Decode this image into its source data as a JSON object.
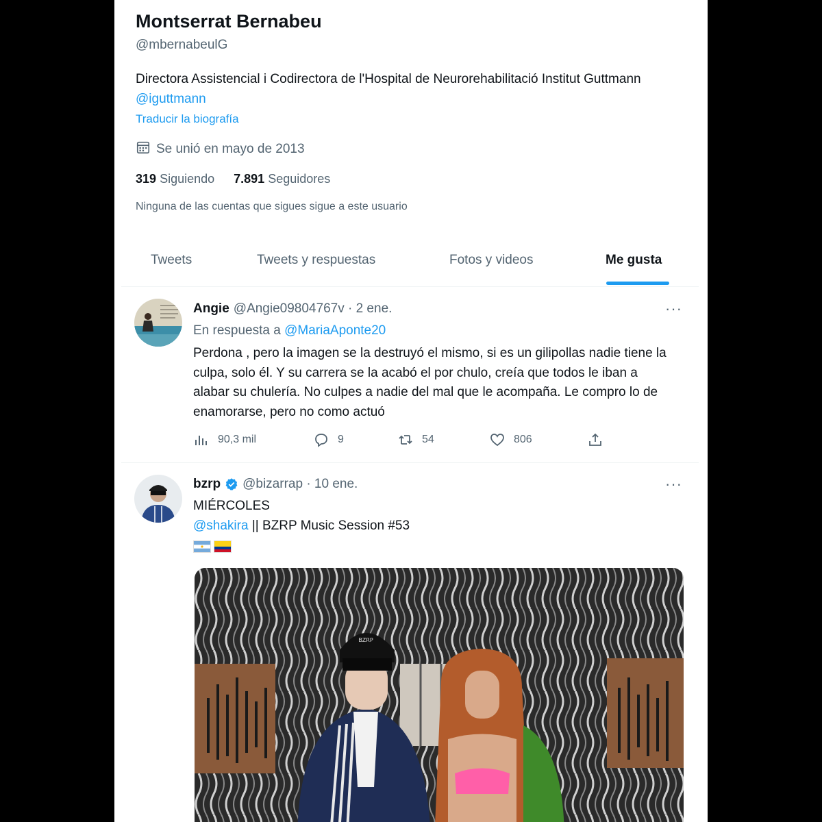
{
  "profile": {
    "name": "Montserrat Bernabeu",
    "handle": "@mbernabeulG",
    "bio_text": "Directora Assistencial i Codirectora de l'Hospital de Neurorehabilitació Institut Guttmann ",
    "bio_mention": "@iguttmann",
    "translate_link": "Traducir la biografía",
    "joined": "Se unió en mayo de 2013",
    "following_count": "319",
    "following_label": "Siguiendo",
    "followers_count": "7.891",
    "followers_label": "Seguidores",
    "no_followers_text": "Ninguna de las cuentas que sigues sigue a este usuario"
  },
  "tabs": [
    {
      "label": "Tweets",
      "active": false
    },
    {
      "label": "Tweets y respuestas",
      "active": false
    },
    {
      "label": "Fotos y videos",
      "active": false
    },
    {
      "label": "Me gusta",
      "active": true
    }
  ],
  "tweets": [
    {
      "author": "Angie",
      "handle": "@Angie09804767v",
      "date": "· 2 ene.",
      "reply_prefix": "En respuesta a",
      "reply_to": "@MariaAponte20",
      "text": "Perdona , pero la imagen se la destruyó el mismo, si es un gilipollas nadie tiene la culpa, solo él. Y su carrera se la acabó el por chulo, creía que todos le iban a alabar su chulería. No culpes a nadie del mal que le acompaña. Le compro lo de enamorarse, pero no como actuó",
      "views": "90,3 mil",
      "replies": "9",
      "retweets": "54",
      "likes": "806",
      "more": "···"
    },
    {
      "author": "bzrp",
      "handle": "@bizarrap",
      "date": "· 10 ene.",
      "verified": true,
      "line1": "MIÉRCOLES",
      "mention": "@shakira",
      "line2_rest": " || BZRP Music Session #53",
      "flags": [
        "argentina-flag",
        "colombia-flag"
      ],
      "more": "···",
      "cap_text": "BZRP"
    }
  ],
  "colors": {
    "accent": "#1d9bf0",
    "text_primary": "#0f1419",
    "text_secondary": "#536471"
  }
}
